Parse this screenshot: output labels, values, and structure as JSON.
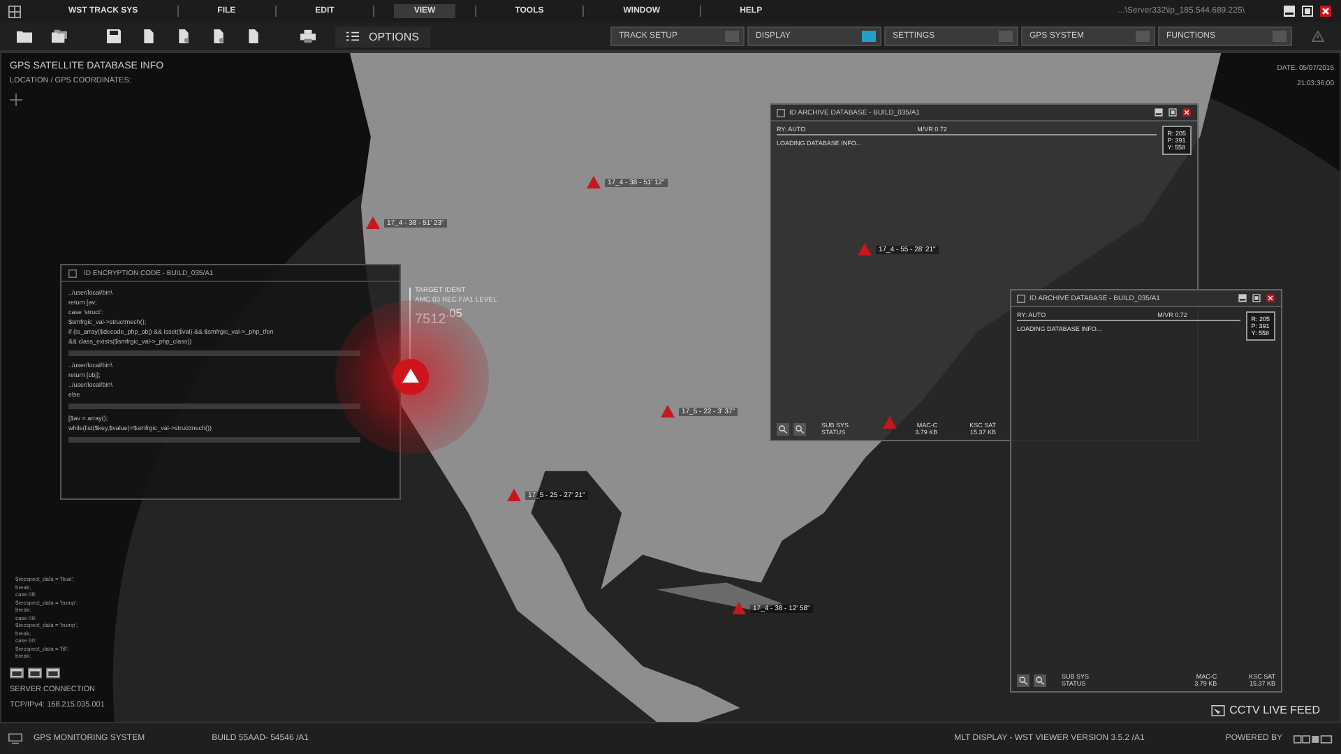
{
  "menu_bar": {
    "items": [
      {
        "label": "WST TRACK SYS",
        "selected": false
      },
      {
        "label": "FILE",
        "selected": false
      },
      {
        "label": "EDIT",
        "selected": false
      },
      {
        "label": "VIEW",
        "selected": true
      },
      {
        "label": "TOOLS",
        "selected": false
      },
      {
        "label": "WINDOW",
        "selected": false
      },
      {
        "label": "HELP",
        "selected": false
      }
    ],
    "server_path": "...\\Server332\\ip_185.544.689.225\\"
  },
  "toolbar": {
    "options_label": "OPTIONS",
    "toggles": [
      {
        "label": "TRACK SETUP",
        "on": false
      },
      {
        "label": "DISPLAY",
        "on": true
      },
      {
        "label": "SETTINGS",
        "on": false
      },
      {
        "label": "GPS SYSTEM",
        "on": false
      },
      {
        "label": "FUNCTIONS",
        "on": false
      }
    ]
  },
  "map": {
    "title": "GPS SATELLITE DATABASE INFO",
    "subtitle": "LOCATION / GPS COORDINATES:",
    "date": "DATE: 05/07/2015",
    "time": "21:03:36:00",
    "markers": [
      {
        "label": "17_4 - 38 - 51' 12\""
      },
      {
        "label": "17_4 - 38 - 51' 23\""
      },
      {
        "label": "17_5 - 22 - 3' 37\""
      },
      {
        "label": "17_5 - 25 - 27' 21\""
      },
      {
        "label": "17_4 - 38 - 12' 58\""
      }
    ],
    "target": {
      "title": "TARGET IDENT",
      "subtitle": "AMC 03 REC F/A1 LEVEL",
      "value": "7512$^{.05}$"
    }
  },
  "code_panel": {
    "title": "ID ENCRYPTION CODE - BUILD_035/A1",
    "lines": [
      "../user/local/bin\\",
      "return [av;",
      "case 'struct':",
      "$smfrgic_val->structmech();",
      "if (is_array($decode_php_obj) && isset($val) && $smfrgic_val->_php_tfen",
      "&& class_exists($smfrgic_val->_php_class))",
      "../user/local/bin\\",
      "return [obj];",
      "../user/local/bin\\",
      "else",
      "[$av = array();",
      "while(list($key,$value)=$smfrgic_val->structmech())"
    ]
  },
  "archive_windows": [
    {
      "title": "ID ARCHIVE DATABASE - BUILD_035/A1",
      "mode": "RY: AUTO",
      "version": "M/VR 0.72",
      "status": "LOADING DATABASE INFO...",
      "readout": [
        "R: 205",
        "P: 391",
        "Y: 558"
      ],
      "footer": [
        "SUB SYS",
        "STATUS"
      ],
      "stats": [
        {
          "name": "MAC-C",
          "value": "3.79 KB"
        },
        {
          "name": "KSC SAT",
          "value": "15.37 KB"
        }
      ],
      "markers": [
        {
          "kind": "labeled",
          "label": "17_4 - 55 - 28' 21\""
        },
        {
          "kind": "plain"
        }
      ]
    },
    {
      "title": "ID ARCHIVE DATABASE - BUILD_035/A1",
      "mode": "RY: AUTO",
      "version": "M/VR 0.72",
      "status": "LOADING DATABASE INFO...",
      "readout": [
        "R: 205",
        "P: 391",
        "Y: 558"
      ],
      "footer": [
        "SUB SYS",
        "STATUS"
      ],
      "stats": [
        {
          "name": "MAC-C",
          "value": "3.79 KB"
        },
        {
          "name": "KSC SAT",
          "value": "15.37 KB"
        }
      ]
    }
  ],
  "console": {
    "lines": [
      "$recspect_data = 'float';",
      "break;",
      "case 08:",
      "$recspect_data = 'bump';",
      "break;",
      "case 09:",
      "$recspect_data = 'bump';",
      "break;",
      "case 60:",
      "$recspect_data = 'fill';",
      "break;"
    ]
  },
  "server": {
    "label": "SERVER CONNECTION",
    "address": "TCP/IPv4: 168.215.035.001"
  },
  "feed_label": "CCTV LIVE FEED",
  "status_bar": {
    "system": "GPS MONITORING SYSTEM",
    "build": "BUILD 55AAD- 54546  /A1",
    "version": "MLT  DISPLAY - WST VIEWER  VERSION 3.5.2 /A1",
    "powered_by": "POWERED BY"
  }
}
